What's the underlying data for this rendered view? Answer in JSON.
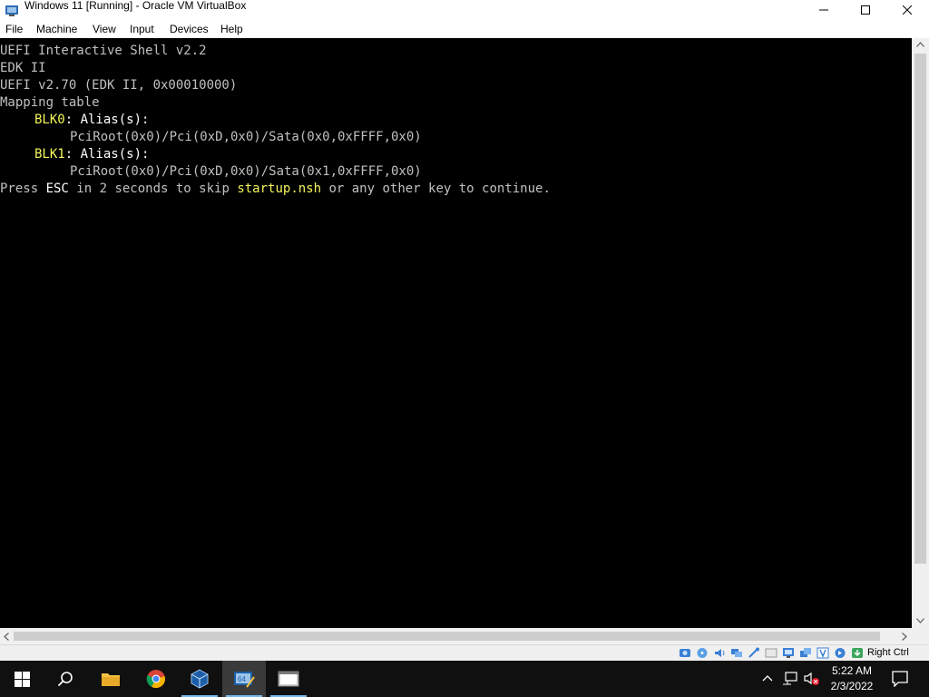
{
  "window": {
    "title": "Windows 11 [Running] - Oracle VM VirtualBox"
  },
  "menu": [
    "File",
    "Machine",
    "View",
    "Input",
    "Devices",
    "Help"
  ],
  "console": {
    "line1": "UEFI Interactive Shell v2.2",
    "line2": "EDK II",
    "line3": "UEFI v2.70 (EDK II, 0x00010000)",
    "line4": "Mapping table",
    "blk0_name": "BLK0",
    "blk0_alias": ": Alias(s):",
    "blk0_path": "PciRoot(0x0)/Pci(0xD,0x0)/Sata(0x0,0xFFFF,0x0)",
    "blk1_name": "BLK1",
    "blk1_alias": ": Alias(s):",
    "blk1_path": "PciRoot(0x0)/Pci(0xD,0x0)/Sata(0x1,0xFFFF,0x0)",
    "press_pre": "Press ",
    "press_esc": "ESC",
    "press_mid": " in 2 seconds to skip ",
    "press_file": "startup.nsh",
    "press_post": " or any other key to continue."
  },
  "statusbar": {
    "host_key": "Right Ctrl",
    "icons": [
      "hard-disk-icon",
      "optical-drive-icon",
      "audio-icon",
      "network-icon",
      "usb-icon",
      "shared-folders-icon",
      "display-icon",
      "video-capture-icon",
      "virtualization-icon",
      "mouse-integration-icon",
      "keyboard-capture-icon"
    ]
  },
  "taskbar": {
    "time": "5:22 AM",
    "date": "2/3/2022",
    "apps": [
      "start-icon",
      "search-icon",
      "file-explorer-icon",
      "chrome-icon",
      "virtualbox-manager-icon",
      "virtualbox-vm-icon",
      "vm-window-icon"
    ]
  },
  "colors": {
    "console_bg": "#000000",
    "console_gray": "#c0c0c0",
    "console_yellow": "#f4f45a",
    "console_white": "#ffffff",
    "taskbar_bg": "#101010",
    "accent": "#76b9ed"
  }
}
